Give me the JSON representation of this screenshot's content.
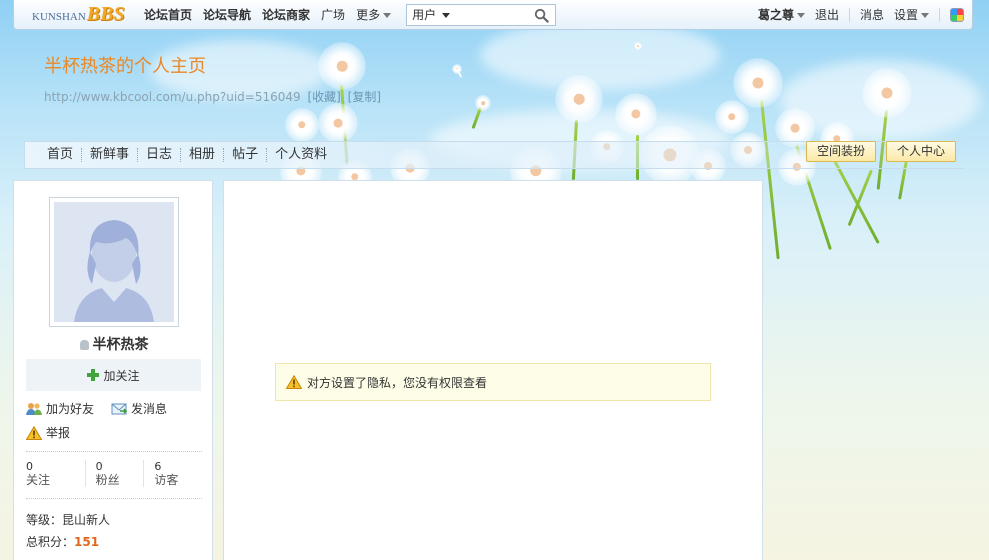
{
  "topbar": {
    "logo": {
      "part1": "KUNSHAN",
      "part2": "BBS"
    },
    "nav": [
      {
        "label": "论坛首页"
      },
      {
        "label": "论坛导航"
      },
      {
        "label": "论坛商家"
      },
      {
        "label": "广场"
      },
      {
        "label": "更多"
      }
    ],
    "search": {
      "scope": "用户",
      "value": "",
      "icon": "search-icon"
    },
    "right": {
      "user": "葛之尊",
      "logout": "退出",
      "messages": "消息",
      "settings": "设置",
      "skin_icon": "color-palette-icon"
    }
  },
  "header": {
    "title": "半杯热茶的个人主页",
    "url": "http://www.kbcool.com/u.php?uid=516049",
    "favorite": "[收藏]",
    "copy": "[复制]"
  },
  "subnav": {
    "items": [
      {
        "label": "首页"
      },
      {
        "label": "新鲜事"
      },
      {
        "label": "日志"
      },
      {
        "label": "相册"
      },
      {
        "label": "帖子"
      },
      {
        "label": "个人资料"
      }
    ],
    "decorate_button": "空间装扮",
    "center_button": "个人中心"
  },
  "profile": {
    "name": "半杯热茶",
    "follow": "加关注",
    "add_friend": "加为好友",
    "send_message": "发消息",
    "report": "举报",
    "stats": [
      {
        "value": "0",
        "label": "关注"
      },
      {
        "value": "0",
        "label": "粉丝"
      },
      {
        "value": "6",
        "label": "访客"
      }
    ],
    "level_label": "等级：",
    "level_value": "昆山新人",
    "points_label": "总积分：",
    "points_value": "151"
  },
  "main": {
    "notice": "对方设置了隐私，您没有权限查看"
  },
  "colors": {
    "title_orange": "#e8892a",
    "points_orange": "#e0681c",
    "notice_bg": "#fefde8",
    "button_yellow": "#fbe9a6"
  }
}
